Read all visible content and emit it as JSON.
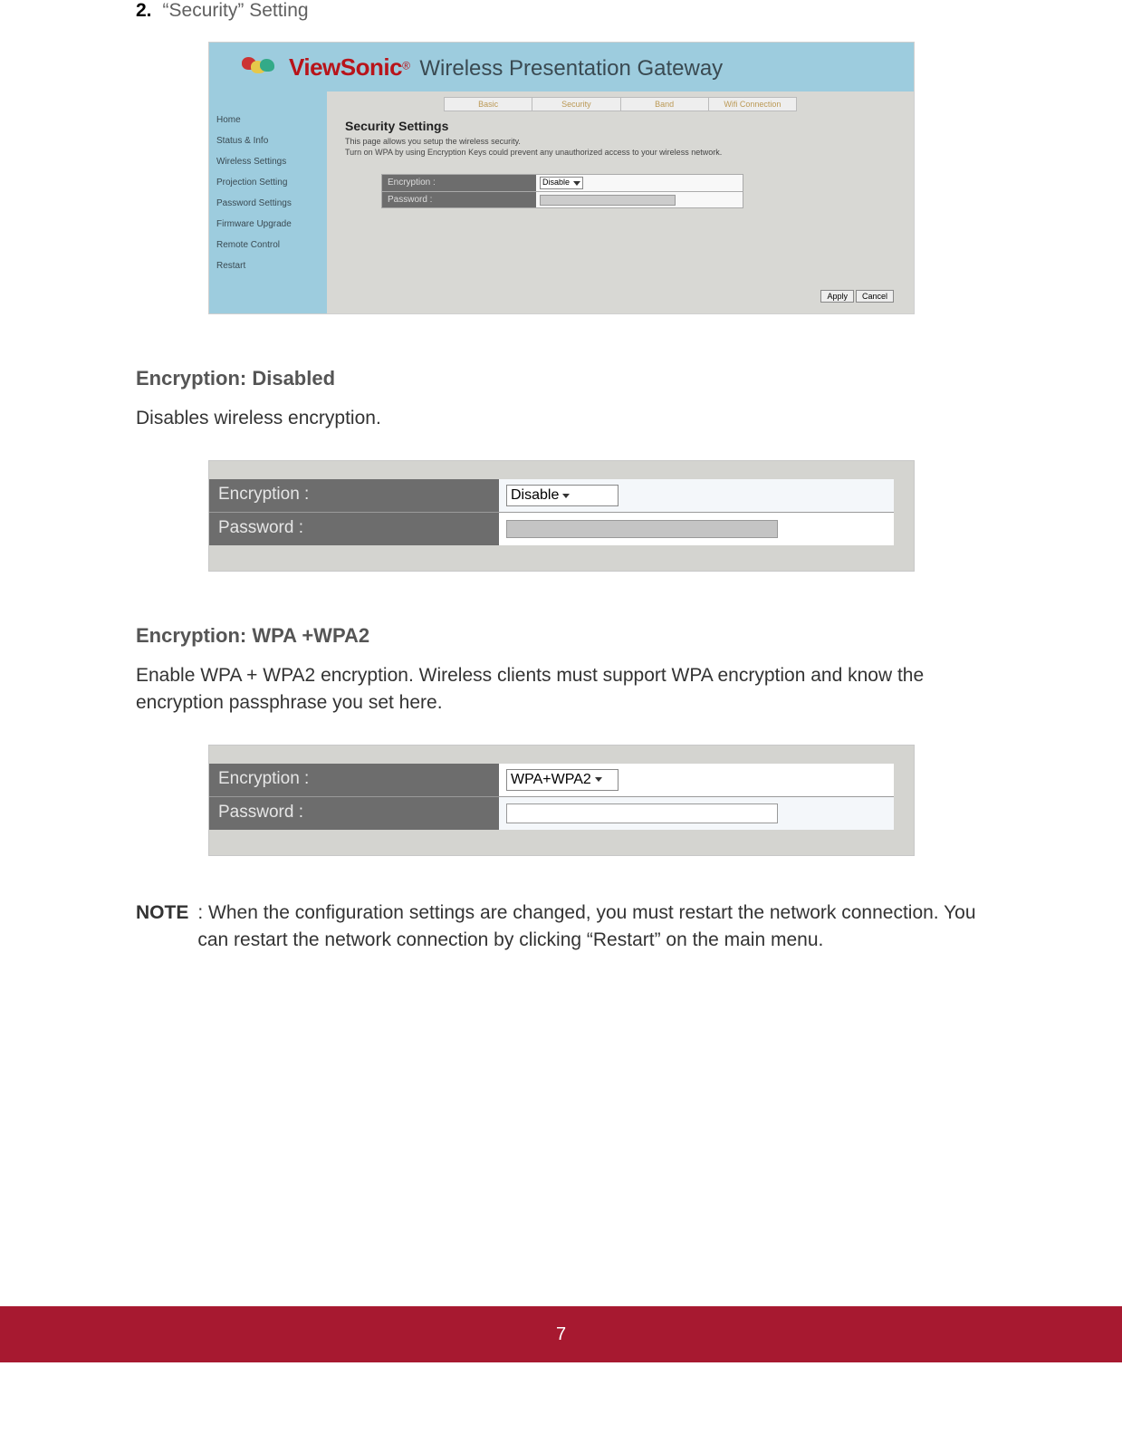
{
  "step": {
    "number": "2.",
    "title": "“Security” Setting"
  },
  "admin": {
    "brand": "ViewSonic",
    "brand_tag": "Wireless Presentation Gateway",
    "sidebar": [
      "Home",
      "Status & Info",
      "Wireless Settings",
      "Projection Setting",
      "Password Settings",
      "Firmware Upgrade",
      "Remote Control",
      "Restart"
    ],
    "tabs": [
      "Basic",
      "Security",
      "Band",
      "Wifi Connection"
    ],
    "title": "Security Settings",
    "desc1": "This page allows you setup the wireless security.",
    "desc2": "Turn on WPA by using Encryption Keys could prevent any unauthorized access to your wireless network.",
    "labels": {
      "encryption": "Encryption :",
      "password": "Password :"
    },
    "select_value": "Disable",
    "buttons": {
      "apply": "Apply",
      "cancel": "Cancel"
    }
  },
  "section1": {
    "heading": "Encryption: Disabled",
    "para": "Disables wireless encryption.",
    "select_value": "Disable"
  },
  "section2": {
    "heading": "Encryption: WPA +WPA2",
    "para": "Enable WPA + WPA2 encryption. Wireless clients must support WPA encryption and know the encryption passphrase you set here.",
    "select_value": "WPA+WPA2"
  },
  "note": {
    "label": "NOTE",
    "text": ": When the configuration settings are changed, you must restart the network connection. You can restart the network connection by clicking “Restart” on the main menu."
  },
  "page_number": "7"
}
